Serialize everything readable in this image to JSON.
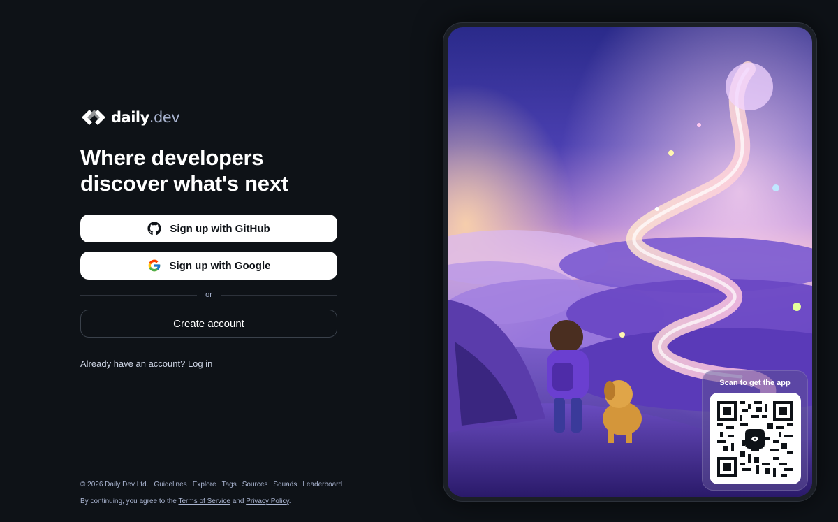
{
  "brand": {
    "name": "daily",
    "suffix": ".dev",
    "logo_icon": "daily-dev-logo-icon"
  },
  "hero": {
    "headline_line1": "Where developers",
    "headline_line2": "discover what's next"
  },
  "auth": {
    "github_label": "Sign up with GitHub",
    "github_icon": "github-icon",
    "google_label": "Sign up with Google",
    "google_icon": "google-icon",
    "divider_text": "or",
    "create_account_label": "Create account",
    "login_prompt": "Already have an account?",
    "login_link": "Log in"
  },
  "footer": {
    "copyright": "© 2026 Daily Dev Ltd.",
    "links": [
      "Guidelines",
      "Explore",
      "Tags",
      "Sources",
      "Squads",
      "Leaderboard"
    ],
    "legal_prefix": "By continuing, you agree to the",
    "terms_link": "Terms of Service",
    "legal_and": "and",
    "privacy_link": "Privacy Policy",
    "legal_suffix": "."
  },
  "promo": {
    "illustration": "child-and-dog-fantasy-landscape-illustration",
    "qr_caption": "Scan to get the app",
    "qr_icon": "qr-code-icon"
  },
  "colors": {
    "background": "#0e1217",
    "button_light": "#ffffff",
    "text_muted": "#a8b3cf",
    "accent_purple": "#7b5cff"
  }
}
